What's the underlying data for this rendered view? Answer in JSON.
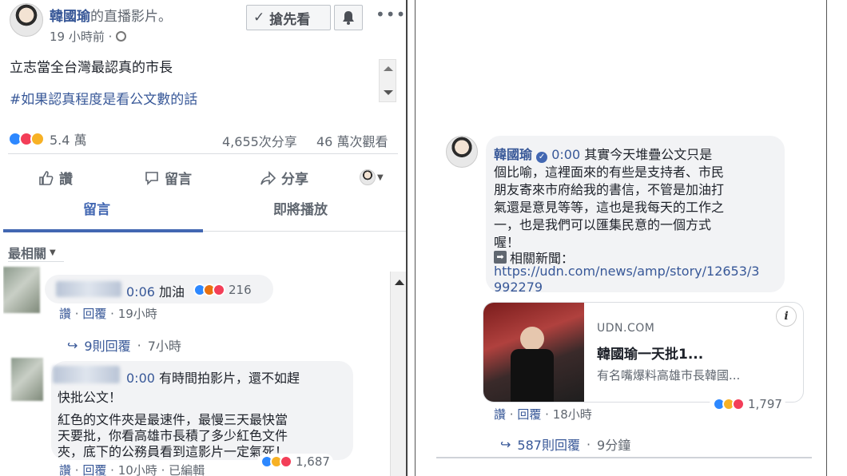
{
  "post": {
    "author": "韓國瑜",
    "title_suffix": "的直播影片。",
    "follow_label": "搶先看",
    "time": "19 小時前 ·",
    "text_line1": "立志當全台灣最認真的市長",
    "text_line2": "#如果認真程度是看公文數的話",
    "reactions_count": "5.4 萬",
    "shares": "4,655次分享",
    "views": "46 萬次觀看",
    "actions": {
      "like": "讚",
      "comment": "留言",
      "share": "分享"
    },
    "tabs": {
      "comments": "留言",
      "up_next": "即將播放"
    },
    "sort_label": "最相關"
  },
  "comments_left": [
    {
      "time_prefix": "0:06",
      "text": "加油",
      "reaction_count": "216",
      "like": "讚",
      "reply": "回覆",
      "time": "19小時"
    },
    {
      "replies": "9則回覆",
      "time": "7小時"
    },
    {
      "time_prefix": "0:00",
      "text_line1": "有時間拍影片，還不如趕",
      "text_line2": "快批公文！",
      "text_line3": "紅色的文件夾是最速件，最慢三天最快當",
      "text_line4": "天要批，你看高雄市長積了多少紅色文件",
      "text_line5": "夾，底下的公務員看到這影片一定氣死！",
      "reaction_count": "1,687",
      "like": "讚",
      "reply": "回覆",
      "time": "10小時",
      "edited": "已編輯"
    }
  ],
  "comment_right": {
    "author": "韓國瑜",
    "time_prefix": "0:00",
    "lines": [
      "其實今天堆疊公文只是",
      "個比喻，這裡面來的有些是支持者、市民",
      "朋友寄來市府給我的書信，不管是加油打",
      "氣還是意見等等，這也是我每天的工作之",
      "一，也是我們可以匯集民意的一個方式",
      "喔！"
    ],
    "related_label": "相關新聞：",
    "url_line1": "https://udn.com/news/amp/story/12653/3",
    "url_line2": "992279",
    "card_domain": "UDN.COM",
    "card_title": "韓國瑜一天批1...",
    "card_desc": "有名嘴爆料高雄市長韓國...",
    "reaction_count": "1,797",
    "like": "讚",
    "reply": "回覆",
    "time": "18小時",
    "replies": "587則回覆",
    "replies_time": "9分鐘"
  },
  "icons": [
    "globe-icon",
    "bell-icon",
    "more-icon",
    "thumbs-up-icon",
    "comment-icon",
    "share-icon",
    "chevron-down-icon",
    "reply-arrow-icon",
    "info-icon",
    "verified-icon",
    "link-icon"
  ],
  "colors": {
    "link": "#385898",
    "like_blue": "#2d88ff",
    "love_red": "#f33e58",
    "haha_yellow": "#f7b125",
    "tab_blue": "#4267b2"
  }
}
